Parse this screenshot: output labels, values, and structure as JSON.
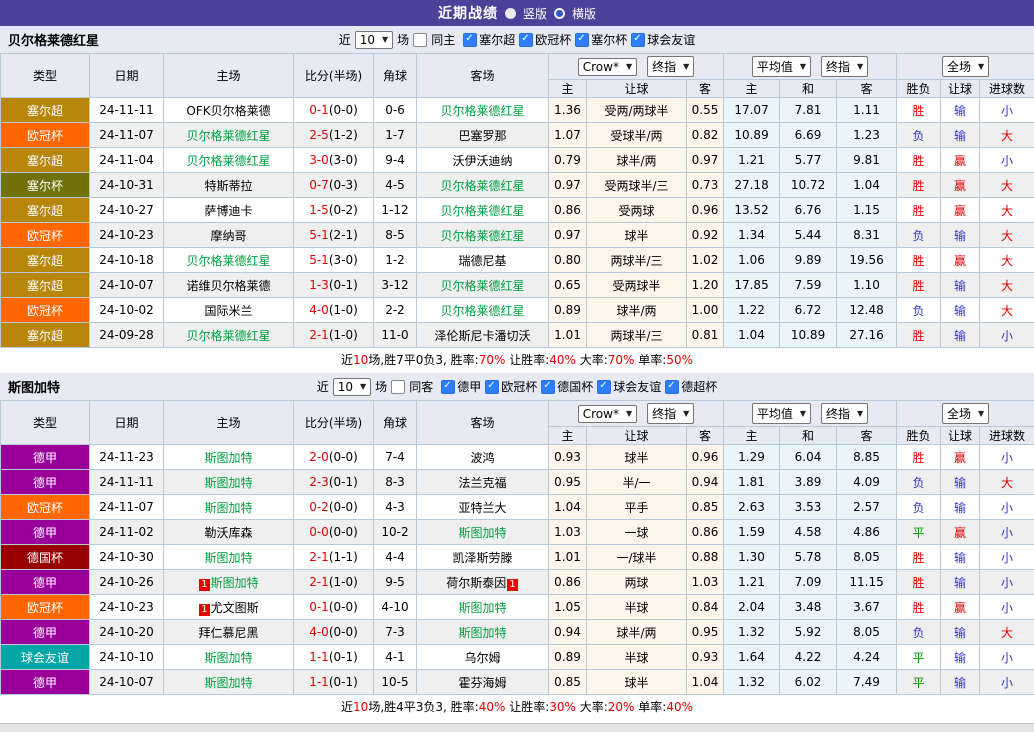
{
  "title_bar": {
    "title": "近期战绩",
    "radios": [
      {
        "label": "竖版",
        "selected": false
      },
      {
        "label": "横版",
        "selected": true
      }
    ]
  },
  "columns": {
    "top": [
      "类型",
      "日期",
      "主场",
      "比分(半场)",
      "角球",
      "客场"
    ],
    "sub": [
      "主",
      "让球",
      "客",
      "主",
      "和",
      "客",
      "胜负",
      "让球",
      "进球数"
    ]
  },
  "selects": {
    "source": "Crow*",
    "final1": "终指",
    "average": "平均值",
    "final2": "终指",
    "scope": "全场"
  },
  "colors": {
    "header_bar": "#4c4199",
    "team_highlight": "#00a040",
    "score": "#e60000",
    "result": {
      "r": "#e60000",
      "b": "#3434cc",
      "g": "#009900"
    },
    "league": {
      "塞尔超": "#b8860b",
      "欧冠杯": "#ff6600",
      "塞尔杯": "#71710a",
      "德甲": "#990099",
      "德国杯": "#990000",
      "球会友谊": "#00a6a6"
    }
  },
  "sections": [
    {
      "team": "贝尔格莱德红星",
      "filter": {
        "near_label": "近",
        "games": "10",
        "games_suffix": "场",
        "same_label": "同主",
        "same_checked": false,
        "leagues": [
          "塞尔超",
          "欧冠杯",
          "塞尔杯",
          "球会友谊"
        ]
      },
      "rows": [
        {
          "league": "塞尔超",
          "date": "24-11-11",
          "home": {
            "n": "OFK贝尔格莱德"
          },
          "score": "0-1",
          "half": "0-0",
          "corner": "0-6",
          "away": {
            "n": "贝尔格莱德红星",
            "g": 1
          },
          "o1": "1.36",
          "hc": "受两/两球半",
          "o2": "0.55",
          "a1": "17.07",
          "a2": "7.81",
          "a3": "1.11",
          "r1": {
            "t": "胜",
            "c": "r"
          },
          "r2": {
            "t": "输",
            "c": "b"
          },
          "r3": {
            "t": "小",
            "c": "b"
          }
        },
        {
          "league": "欧冠杯",
          "date": "24-11-07",
          "home": {
            "n": "贝尔格莱德红星",
            "g": 1
          },
          "score": "2-5",
          "half": "1-2",
          "corner": "1-7",
          "away": {
            "n": "巴塞罗那"
          },
          "o1": "1.07",
          "hc": "受球半/两",
          "o2": "0.82",
          "a1": "10.89",
          "a2": "6.69",
          "a3": "1.23",
          "r1": {
            "t": "负",
            "c": "b"
          },
          "r2": {
            "t": "输",
            "c": "b"
          },
          "r3": {
            "t": "大",
            "c": "r"
          }
        },
        {
          "league": "塞尔超",
          "date": "24-11-04",
          "home": {
            "n": "贝尔格莱德红星",
            "g": 1
          },
          "score": "3-0",
          "half": "3-0",
          "corner": "9-4",
          "away": {
            "n": "沃伊沃迪纳"
          },
          "o1": "0.79",
          "hc": "球半/两",
          "o2": "0.97",
          "a1": "1.21",
          "a2": "5.77",
          "a3": "9.81",
          "r1": {
            "t": "胜",
            "c": "r"
          },
          "r2": {
            "t": "赢",
            "c": "r"
          },
          "r3": {
            "t": "小",
            "c": "b"
          }
        },
        {
          "league": "塞尔杯",
          "date": "24-10-31",
          "home": {
            "n": "特斯蒂拉"
          },
          "score": "0-7",
          "half": "0-3",
          "corner": "4-5",
          "away": {
            "n": "贝尔格莱德红星",
            "g": 1
          },
          "o1": "0.97",
          "hc": "受两球半/三",
          "o2": "0.73",
          "a1": "27.18",
          "a2": "10.72",
          "a3": "1.04",
          "r1": {
            "t": "胜",
            "c": "r"
          },
          "r2": {
            "t": "赢",
            "c": "r"
          },
          "r3": {
            "t": "大",
            "c": "r"
          }
        },
        {
          "league": "塞尔超",
          "date": "24-10-27",
          "home": {
            "n": "萨博迪卡"
          },
          "score": "1-5",
          "half": "0-2",
          "corner": "1-12",
          "away": {
            "n": "贝尔格莱德红星",
            "g": 1
          },
          "o1": "0.86",
          "hc": "受两球",
          "o2": "0.96",
          "a1": "13.52",
          "a2": "6.76",
          "a3": "1.15",
          "r1": {
            "t": "胜",
            "c": "r"
          },
          "r2": {
            "t": "赢",
            "c": "r"
          },
          "r3": {
            "t": "大",
            "c": "r"
          }
        },
        {
          "league": "欧冠杯",
          "date": "24-10-23",
          "home": {
            "n": "摩纳哥"
          },
          "score": "5-1",
          "half": "2-1",
          "corner": "8-5",
          "away": {
            "n": "贝尔格莱德红星",
            "g": 1
          },
          "o1": "0.97",
          "hc": "球半",
          "o2": "0.92",
          "a1": "1.34",
          "a2": "5.44",
          "a3": "8.31",
          "r1": {
            "t": "负",
            "c": "b"
          },
          "r2": {
            "t": "输",
            "c": "b"
          },
          "r3": {
            "t": "大",
            "c": "r"
          }
        },
        {
          "league": "塞尔超",
          "date": "24-10-18",
          "home": {
            "n": "贝尔格莱德红星",
            "g": 1
          },
          "score": "5-1",
          "half": "3-0",
          "corner": "1-2",
          "away": {
            "n": "瑞德尼基"
          },
          "o1": "0.80",
          "hc": "两球半/三",
          "o2": "1.02",
          "a1": "1.06",
          "a2": "9.89",
          "a3": "19.56",
          "r1": {
            "t": "胜",
            "c": "r"
          },
          "r2": {
            "t": "赢",
            "c": "r"
          },
          "r3": {
            "t": "大",
            "c": "r"
          }
        },
        {
          "league": "塞尔超",
          "date": "24-10-07",
          "home": {
            "n": "诺维贝尔格莱德"
          },
          "score": "1-3",
          "half": "0-1",
          "corner": "3-12",
          "away": {
            "n": "贝尔格莱德红星",
            "g": 1
          },
          "o1": "0.65",
          "hc": "受两球半",
          "o2": "1.20",
          "a1": "17.85",
          "a2": "7.59",
          "a3": "1.10",
          "r1": {
            "t": "胜",
            "c": "r"
          },
          "r2": {
            "t": "输",
            "c": "b"
          },
          "r3": {
            "t": "大",
            "c": "r"
          }
        },
        {
          "league": "欧冠杯",
          "date": "24-10-02",
          "home": {
            "n": "国际米兰"
          },
          "score": "4-0",
          "half": "1-0",
          "corner": "2-2",
          "away": {
            "n": "贝尔格莱德红星",
            "g": 1
          },
          "o1": "0.89",
          "hc": "球半/两",
          "o2": "1.00",
          "a1": "1.22",
          "a2": "6.72",
          "a3": "12.48",
          "r1": {
            "t": "负",
            "c": "b"
          },
          "r2": {
            "t": "输",
            "c": "b"
          },
          "r3": {
            "t": "大",
            "c": "r"
          }
        },
        {
          "league": "塞尔超",
          "date": "24-09-28",
          "home": {
            "n": "贝尔格莱德红星",
            "g": 1
          },
          "score": "2-1",
          "half": "1-0",
          "corner": "11-0",
          "away": {
            "n": "泽伦斯尼卡潘切沃"
          },
          "o1": "1.01",
          "hc": "两球半/三",
          "o2": "0.81",
          "a1": "1.04",
          "a2": "10.89",
          "a3": "27.16",
          "r1": {
            "t": "胜",
            "c": "r"
          },
          "r2": {
            "t": "输",
            "c": "b"
          },
          "r3": {
            "t": "小",
            "c": "b"
          }
        }
      ],
      "summary": [
        {
          "t": "近"
        },
        {
          "t": "10",
          "r": 1
        },
        {
          "t": "场,胜7平0负3, 胜率:"
        },
        {
          "t": "70%",
          "r": 1
        },
        {
          "t": " 让胜率:"
        },
        {
          "t": "40%",
          "r": 1
        },
        {
          "t": " 大率:"
        },
        {
          "t": "70%",
          "r": 1
        },
        {
          "t": " 单率:"
        },
        {
          "t": "50%",
          "r": 1
        }
      ]
    },
    {
      "team": "斯图加特",
      "filter": {
        "near_label": "近",
        "games": "10",
        "games_suffix": "场",
        "same_label": "同客",
        "same_checked": false,
        "leagues": [
          "德甲",
          "欧冠杯",
          "德国杯",
          "球会友谊",
          "德超杯"
        ]
      },
      "rows": [
        {
          "league": "德甲",
          "date": "24-11-23",
          "home": {
            "n": "斯图加特",
            "g": 1
          },
          "score": "2-0",
          "half": "0-0",
          "corner": "7-4",
          "away": {
            "n": "波鸿"
          },
          "o1": "0.93",
          "hc": "球半",
          "o2": "0.96",
          "a1": "1.29",
          "a2": "6.04",
          "a3": "8.85",
          "r1": {
            "t": "胜",
            "c": "r"
          },
          "r2": {
            "t": "赢",
            "c": "r"
          },
          "r3": {
            "t": "小",
            "c": "b"
          }
        },
        {
          "league": "德甲",
          "date": "24-11-11",
          "home": {
            "n": "斯图加特",
            "g": 1
          },
          "score": "2-3",
          "half": "0-1",
          "corner": "8-3",
          "away": {
            "n": "法兰克福"
          },
          "o1": "0.95",
          "hc": "半/一",
          "o2": "0.94",
          "a1": "1.81",
          "a2": "3.89",
          "a3": "4.09",
          "r1": {
            "t": "负",
            "c": "b"
          },
          "r2": {
            "t": "输",
            "c": "b"
          },
          "r3": {
            "t": "大",
            "c": "r"
          }
        },
        {
          "league": "欧冠杯",
          "date": "24-11-07",
          "home": {
            "n": "斯图加特",
            "g": 1
          },
          "score": "0-2",
          "half": "0-0",
          "corner": "4-3",
          "away": {
            "n": "亚特兰大"
          },
          "o1": "1.04",
          "hc": "平手",
          "o2": "0.85",
          "a1": "2.63",
          "a2": "3.53",
          "a3": "2.57",
          "r1": {
            "t": "负",
            "c": "b"
          },
          "r2": {
            "t": "输",
            "c": "b"
          },
          "r3": {
            "t": "小",
            "c": "b"
          }
        },
        {
          "league": "德甲",
          "date": "24-11-02",
          "home": {
            "n": "勒沃库森"
          },
          "score": "0-0",
          "half": "0-0",
          "corner": "10-2",
          "away": {
            "n": "斯图加特",
            "g": 1
          },
          "o1": "1.03",
          "hc": "一球",
          "o2": "0.86",
          "a1": "1.59",
          "a2": "4.58",
          "a3": "4.86",
          "r1": {
            "t": "平",
            "c": "g"
          },
          "r2": {
            "t": "赢",
            "c": "r"
          },
          "r3": {
            "t": "小",
            "c": "b"
          }
        },
        {
          "league": "德国杯",
          "date": "24-10-30",
          "home": {
            "n": "斯图加特",
            "g": 1
          },
          "score": "2-1",
          "half": "1-1",
          "corner": "4-4",
          "away": {
            "n": "凯泽斯劳滕"
          },
          "o1": "1.01",
          "hc": "一/球半",
          "o2": "0.88",
          "a1": "1.30",
          "a2": "5.78",
          "a3": "8.05",
          "r1": {
            "t": "胜",
            "c": "r"
          },
          "r2": {
            "t": "输",
            "c": "b"
          },
          "r3": {
            "t": "小",
            "c": "b"
          }
        },
        {
          "league": "德甲",
          "date": "24-10-26",
          "home": {
            "n": "斯图加特",
            "g": 1,
            "cb": "1"
          },
          "score": "2-1",
          "half": "1-0",
          "corner": "9-5",
          "away": {
            "n": "荷尔斯泰因",
            "ca": "1"
          },
          "o1": "0.86",
          "hc": "两球",
          "o2": "1.03",
          "a1": "1.21",
          "a2": "7.09",
          "a3": "11.15",
          "r1": {
            "t": "胜",
            "c": "r"
          },
          "r2": {
            "t": "输",
            "c": "b"
          },
          "r3": {
            "t": "小",
            "c": "b"
          }
        },
        {
          "league": "欧冠杯",
          "date": "24-10-23",
          "home": {
            "n": "尤文图斯",
            "cb": "1"
          },
          "score": "0-1",
          "half": "0-0",
          "corner": "4-10",
          "away": {
            "n": "斯图加特",
            "g": 1
          },
          "o1": "1.05",
          "hc": "半球",
          "o2": "0.84",
          "a1": "2.04",
          "a2": "3.48",
          "a3": "3.67",
          "r1": {
            "t": "胜",
            "c": "r"
          },
          "r2": {
            "t": "赢",
            "c": "r"
          },
          "r3": {
            "t": "小",
            "c": "b"
          }
        },
        {
          "league": "德甲",
          "date": "24-10-20",
          "home": {
            "n": "拜仁慕尼黑"
          },
          "score": "4-0",
          "half": "0-0",
          "corner": "7-3",
          "away": {
            "n": "斯图加特",
            "g": 1
          },
          "o1": "0.94",
          "hc": "球半/两",
          "o2": "0.95",
          "a1": "1.32",
          "a2": "5.92",
          "a3": "8.05",
          "r1": {
            "t": "负",
            "c": "b"
          },
          "r2": {
            "t": "输",
            "c": "b"
          },
          "r3": {
            "t": "大",
            "c": "r"
          }
        },
        {
          "league": "球会友谊",
          "date": "24-10-10",
          "home": {
            "n": "斯图加特",
            "g": 1
          },
          "score": "1-1",
          "half": "0-1",
          "corner": "4-1",
          "away": {
            "n": "乌尔姆"
          },
          "o1": "0.89",
          "hc": "半球",
          "o2": "0.93",
          "a1": "1.64",
          "a2": "4.22",
          "a3": "4.24",
          "r1": {
            "t": "平",
            "c": "g"
          },
          "r2": {
            "t": "输",
            "c": "b"
          },
          "r3": {
            "t": "小",
            "c": "b"
          }
        },
        {
          "league": "德甲",
          "date": "24-10-07",
          "home": {
            "n": "斯图加特",
            "g": 1
          },
          "score": "1-1",
          "half": "0-1",
          "corner": "10-5",
          "away": {
            "n": "霍芬海姆"
          },
          "o1": "0.85",
          "hc": "球半",
          "o2": "1.04",
          "a1": "1.32",
          "a2": "6.02",
          "a3": "7.49",
          "r1": {
            "t": "平",
            "c": "g"
          },
          "r2": {
            "t": "输",
            "c": "b"
          },
          "r3": {
            "t": "小",
            "c": "b"
          }
        }
      ],
      "summary": [
        {
          "t": "近"
        },
        {
          "t": "10",
          "r": 1
        },
        {
          "t": "场,胜4平3负3, 胜率:"
        },
        {
          "t": "40%",
          "r": 1
        },
        {
          "t": " 让胜率:"
        },
        {
          "t": "30%",
          "r": 1
        },
        {
          "t": " 大率:"
        },
        {
          "t": "20%",
          "r": 1
        },
        {
          "t": " 单率:"
        },
        {
          "t": "40%",
          "r": 1
        }
      ]
    }
  ]
}
